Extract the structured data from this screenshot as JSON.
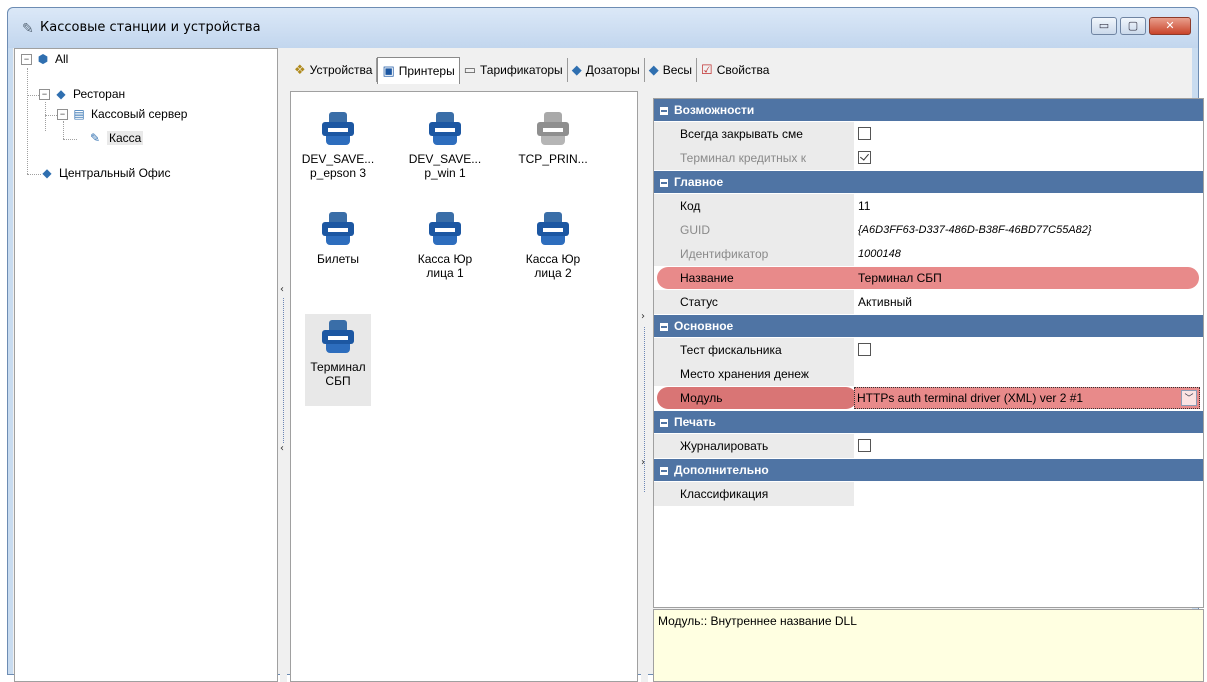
{
  "window": {
    "title": "Кассовые станции и устройства",
    "buttons": {
      "minimize": "▭",
      "maximize": "▢",
      "close": "✕"
    }
  },
  "tree": {
    "root": "All",
    "restaurant": "Ресторан",
    "server": "Кассовый сервер",
    "kassa": "Касса",
    "office": "Центральный Офис"
  },
  "tabs": [
    "Устройства",
    "Принтеры",
    "Тарификаторы",
    "Дозаторы",
    "Весы",
    "Свойства"
  ],
  "printers": [
    {
      "line1": "DEV_SAVE...",
      "line2": "p_epson 3"
    },
    {
      "line1": "DEV_SAVE...",
      "line2": "p_win 1"
    },
    {
      "line1": "TCP_PRIN...",
      "line2": ""
    },
    {
      "line1": "Билеты",
      "line2": ""
    },
    {
      "line1": "Касса Юр",
      "line2": "лица 1"
    },
    {
      "line1": "Касса Юр",
      "line2": "лица 2"
    },
    {
      "line1": "Терминал",
      "line2": "СБП"
    }
  ],
  "props": {
    "cat1": "Возможности",
    "always_close": "Всегда закрывать сме",
    "credit_term": "Терминал кредитных к",
    "cat2": "Главное",
    "code_label": "Код",
    "code_value": "11",
    "guid_label": "GUID",
    "guid_value": "{A6D3FF63-D337-486D-B38F-46BD77C55A82}",
    "ident_label": "Идентификатор",
    "ident_value": "1000148",
    "name_label": "Название",
    "name_value": "Терминал СБП",
    "status_label": "Статус",
    "status_value": "Активный",
    "cat3": "Основное",
    "test_fiscal": "Тест фискальника",
    "money_place": "Место хранения денеж",
    "module_label": "Модуль",
    "module_value": "HTTPs auth terminal driver (XML) ver 2 #1",
    "cat4": "Печать",
    "journal": "Журналировать",
    "cat5": "Дополнительно",
    "classif": "Классификация"
  },
  "help_text": "Модуль:: Внутреннее название DLL"
}
